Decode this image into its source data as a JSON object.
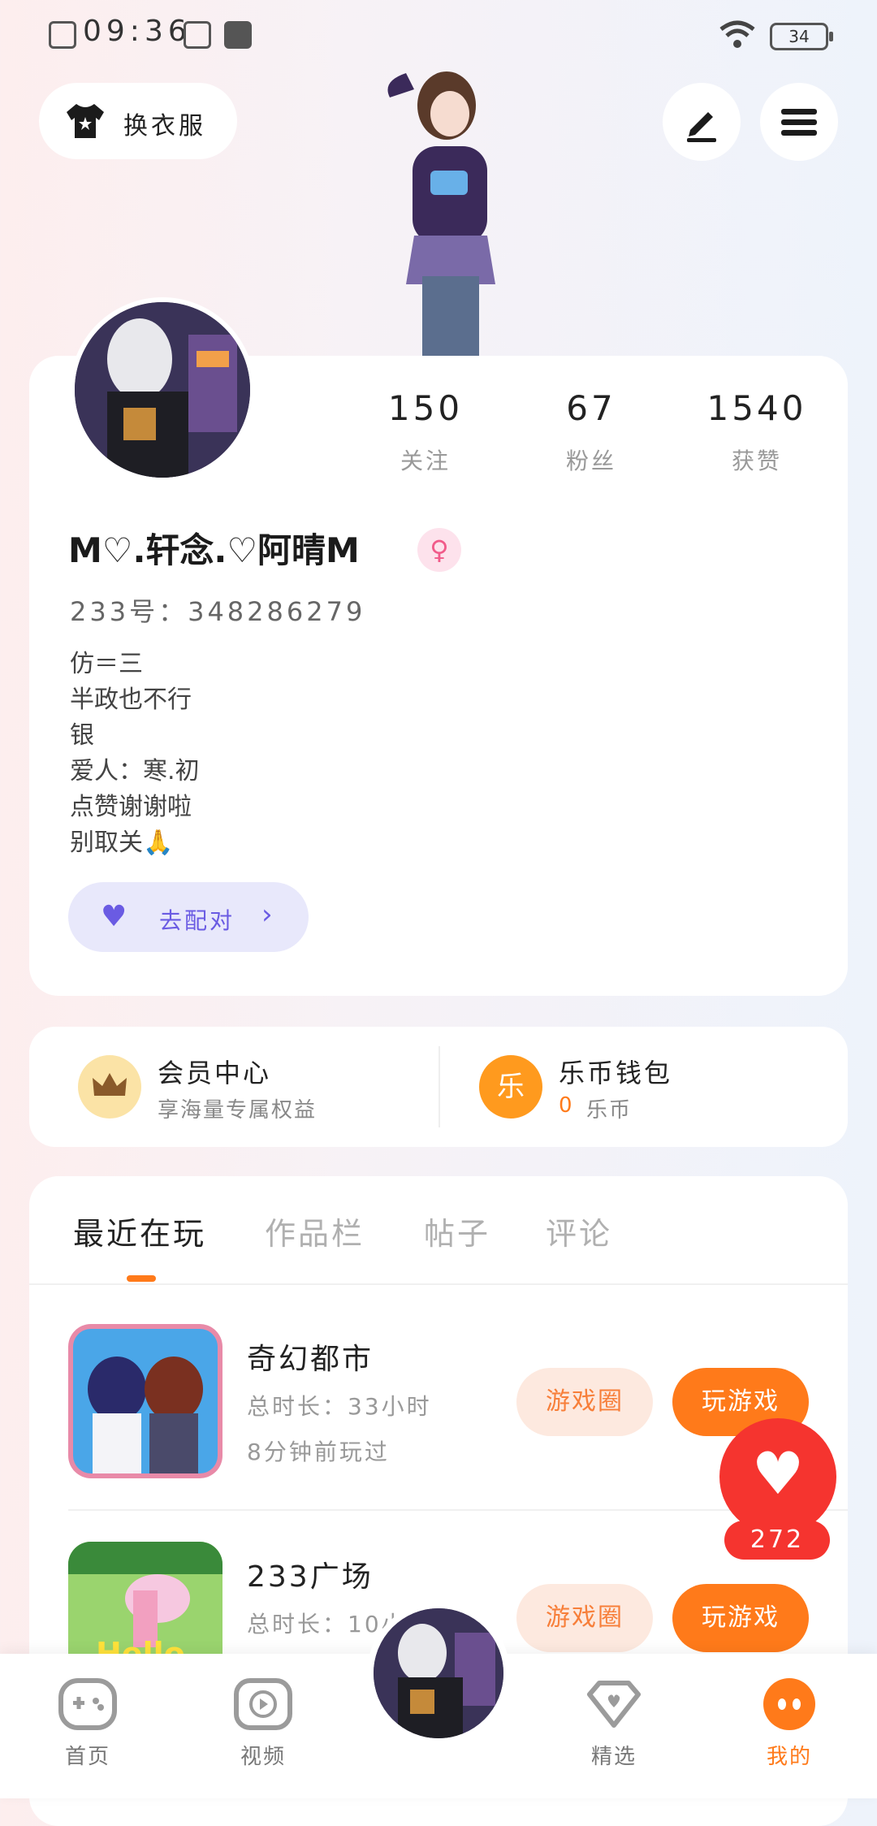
{
  "status_bar": {
    "time": "09:36",
    "battery": "34"
  },
  "top_bar": {
    "change_outfit_label": "换衣服"
  },
  "profile": {
    "stats": [
      {
        "value": "150",
        "label": "关注"
      },
      {
        "value": "67",
        "label": "粉丝"
      },
      {
        "value": "1540",
        "label": "获赞"
      }
    ],
    "nickname": "M♡.轩念.♡阿晴M",
    "gender_symbol": "♀",
    "uid": "233号：348286279",
    "bio_lines": [
      "仿＝三",
      "半政也不行",
      "银",
      "爱人：寒.初",
      "点赞谢谢啦",
      "别取关🙏"
    ],
    "match_label": "去配对",
    "match_chevron": "›"
  },
  "vip": {
    "member_title": "会员中心",
    "member_sub": "享海量专属权益",
    "member_icon": "crown-icon",
    "wallet_title": "乐币钱包",
    "wallet_amount": "0",
    "wallet_unit": "乐币",
    "wallet_icon_text": "乐"
  },
  "tabs": [
    "最近在玩",
    "作品栏",
    "帖子",
    "评论"
  ],
  "games": [
    {
      "name": "奇幻都市",
      "duration": "总时长：33小时",
      "last_played": "8分钟前玩过",
      "circle_label": "游戏圈",
      "play_label": "玩游戏"
    },
    {
      "name": "233广场",
      "duration": "总时长：10小",
      "circle_label": "游戏圈",
      "play_label": "玩游戏",
      "icon_text": "Hello"
    }
  ],
  "floating": {
    "like_count": "272"
  },
  "bottom_nav": [
    {
      "label": "首页"
    },
    {
      "label": "视频"
    },
    {
      "label": "精选"
    },
    {
      "label": "我的"
    }
  ],
  "colors": {
    "accent": "#ff7a1a",
    "like": "#f5342f",
    "match": "#6a5be3"
  }
}
